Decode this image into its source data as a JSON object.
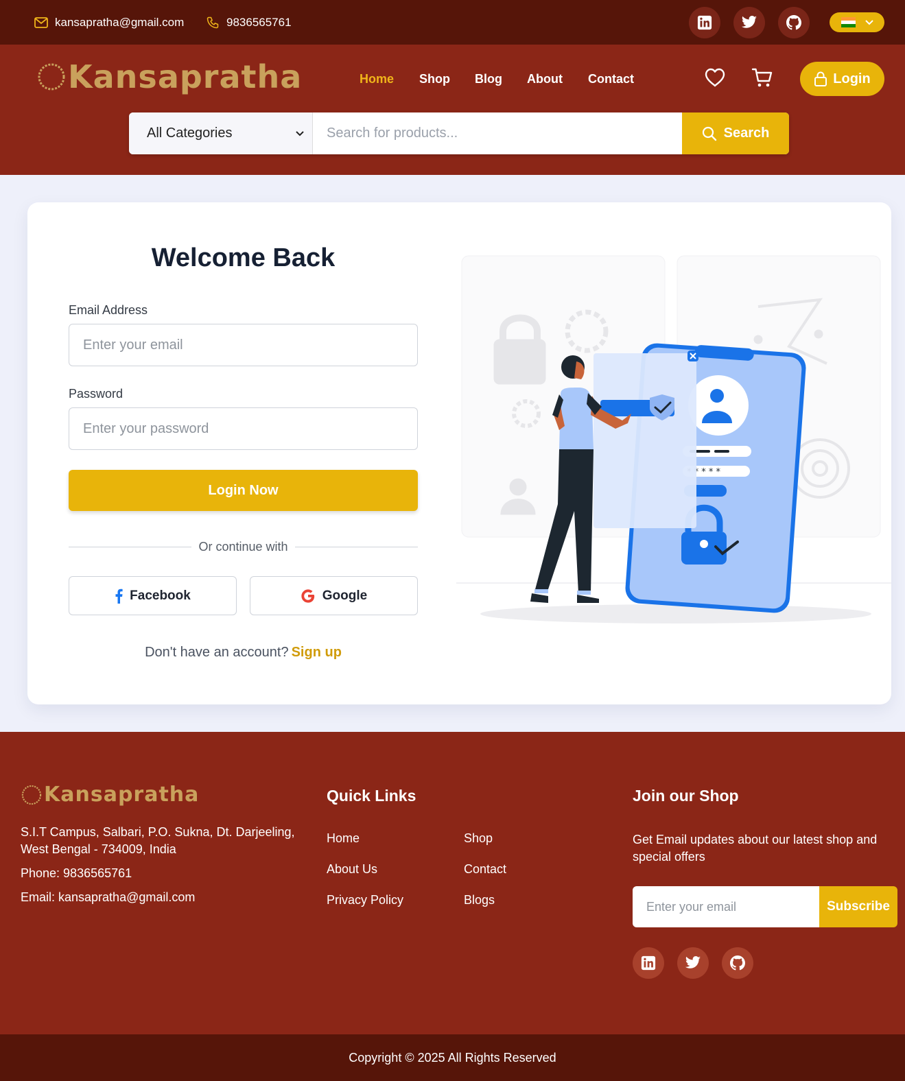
{
  "topbar": {
    "email": "kansapratha@gmail.com",
    "phone": "9836565761",
    "social_icons": [
      "linkedin-icon",
      "twitter-icon",
      "github-icon"
    ],
    "language_flag": "india-flag-icon"
  },
  "header": {
    "logo": "Kansapratha",
    "nav": [
      {
        "label": "Home",
        "active": true
      },
      {
        "label": "Shop",
        "active": false
      },
      {
        "label": "Blog",
        "active": false
      },
      {
        "label": "About",
        "active": false
      },
      {
        "label": "Contact",
        "active": false
      }
    ],
    "icons": [
      "heart-icon",
      "cart-icon"
    ],
    "login_label": "Login",
    "search": {
      "category": "All Categories",
      "placeholder": "Search for products...",
      "button_label": "Search"
    }
  },
  "login_form": {
    "title": "Welcome Back",
    "email_label": "Email Address",
    "email_placeholder": "Enter your email",
    "password_label": "Password",
    "password_placeholder": "Enter your password",
    "submit_label": "Login Now",
    "divider_text": "Or continue with",
    "facebook_label": "Facebook",
    "google_label": "Google",
    "signup_prompt": "Don't have an account?",
    "signup_link": "Sign up"
  },
  "footer": {
    "logo": "Kansapratha",
    "address_line1": "S.I.T Campus, Salbari, P.O. Sukna, Dt. Darjeeling,",
    "address_line2": "West Bengal - 734009, India",
    "phone": "Phone: 9836565761",
    "email": "Email: kansapratha@gmail.com",
    "quick_links_title": "Quick Links",
    "quick_links": [
      "Home",
      "Shop",
      "About Us",
      "Contact",
      "Privacy Policy",
      "Blogs"
    ],
    "join_title": "Join our Shop",
    "join_text": "Get Email updates about our latest shop and special offers",
    "subscribe_placeholder": "Enter your email",
    "subscribe_label": "Subscribe",
    "copyright": "Copyright © 2025 All Rights Reserved"
  },
  "colors": {
    "topbar": "#561509",
    "header": "#8b2617",
    "accent": "#e8b40a",
    "page_bg": "#eef0fa",
    "illustration_blue": "#1a73e8"
  }
}
